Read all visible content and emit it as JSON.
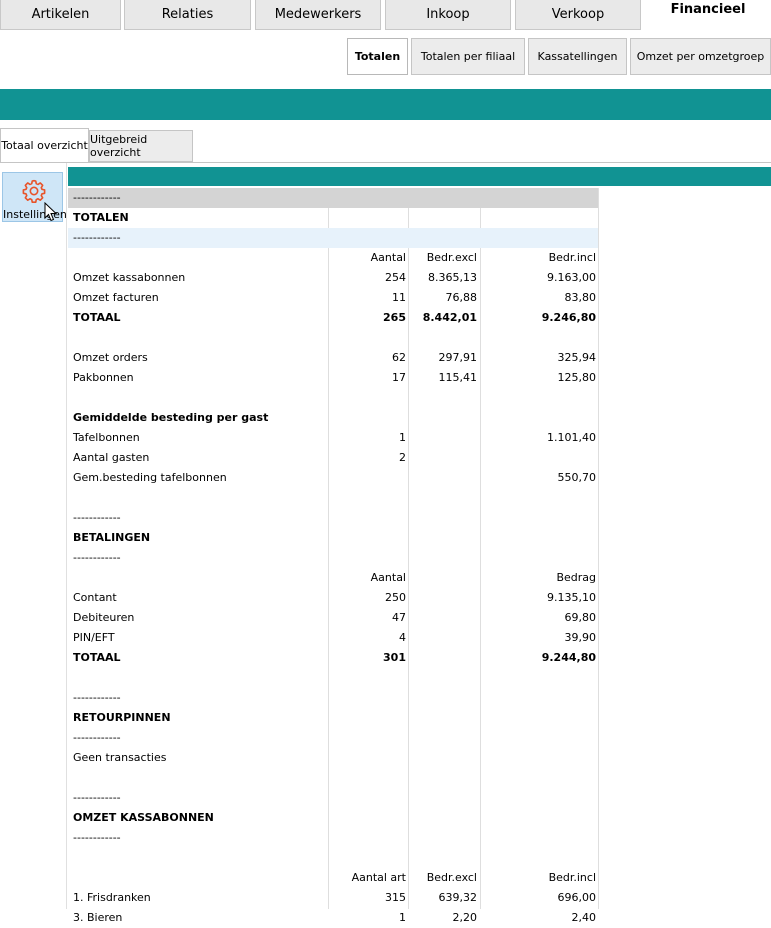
{
  "main_tabs": [
    {
      "label": "Artikelen",
      "active": false
    },
    {
      "label": "Relaties",
      "active": false
    },
    {
      "label": "Medewerkers",
      "active": false
    },
    {
      "label": "Inkoop",
      "active": false
    },
    {
      "label": "Verkoop",
      "active": false
    },
    {
      "label": "Financieel",
      "active": true
    }
  ],
  "sub_tabs": [
    {
      "label": "Totalen",
      "active": true
    },
    {
      "label": "Totalen per filiaal",
      "active": false
    },
    {
      "label": "Kassatellingen",
      "active": false
    },
    {
      "label": "Omzet per omzetgroep",
      "active": false
    }
  ],
  "view_tabs": [
    {
      "label": "Totaal overzicht",
      "active": true
    },
    {
      "label": "Uitgebreid overzicht",
      "active": false
    }
  ],
  "settings": {
    "label": "Instellingen",
    "icon": "gear-icon"
  },
  "colors": {
    "teal": "#119393",
    "icon_orange": "#e8542a",
    "header_gray": "#d4d4d4",
    "selected_blue": "#cfe6f7"
  },
  "report_rows": [
    {
      "cells": [
        "------------",
        "",
        "",
        ""
      ],
      "style": "hdr"
    },
    {
      "cells": [
        "TOTALEN",
        "",
        "",
        ""
      ],
      "style": "bold"
    },
    {
      "cells": [
        "------------",
        "",
        "",
        ""
      ],
      "style": "light"
    },
    {
      "cells": [
        "",
        "Aantal",
        "Bedr.excl",
        "Bedr.incl"
      ],
      "style": ""
    },
    {
      "cells": [
        "Omzet kassabonnen",
        "254",
        "8.365,13",
        "9.163,00"
      ],
      "style": ""
    },
    {
      "cells": [
        "Omzet facturen",
        "11",
        "76,88",
        "83,80"
      ],
      "style": ""
    },
    {
      "cells": [
        "TOTAAL",
        "265",
        "8.442,01",
        "9.246,80"
      ],
      "style": "bold"
    },
    {
      "cells": [
        "",
        "",
        "",
        ""
      ],
      "style": ""
    },
    {
      "cells": [
        "Omzet orders",
        "62",
        "297,91",
        "325,94"
      ],
      "style": ""
    },
    {
      "cells": [
        "Pakbonnen",
        "17",
        "115,41",
        "125,80"
      ],
      "style": ""
    },
    {
      "cells": [
        "",
        "",
        "",
        ""
      ],
      "style": ""
    },
    {
      "cells": [
        "Gemiddelde besteding per gast",
        "",
        "",
        ""
      ],
      "style": "bold"
    },
    {
      "cells": [
        "Tafelbonnen",
        "1",
        "",
        "1.101,40"
      ],
      "style": ""
    },
    {
      "cells": [
        "Aantal gasten",
        "2",
        "",
        ""
      ],
      "style": ""
    },
    {
      "cells": [
        "Gem.besteding tafelbonnen",
        "",
        "",
        "550,70"
      ],
      "style": ""
    },
    {
      "cells": [
        "",
        "",
        "",
        ""
      ],
      "style": ""
    },
    {
      "cells": [
        "------------",
        "",
        "",
        ""
      ],
      "style": ""
    },
    {
      "cells": [
        "BETALINGEN",
        "",
        "",
        ""
      ],
      "style": "bold"
    },
    {
      "cells": [
        "------------",
        "",
        "",
        ""
      ],
      "style": ""
    },
    {
      "cells": [
        "",
        "Aantal",
        "",
        "Bedrag"
      ],
      "style": ""
    },
    {
      "cells": [
        "Contant",
        "250",
        "",
        "9.135,10"
      ],
      "style": ""
    },
    {
      "cells": [
        "Debiteuren",
        "47",
        "",
        "69,80"
      ],
      "style": ""
    },
    {
      "cells": [
        "PIN/EFT",
        "4",
        "",
        "39,90"
      ],
      "style": ""
    },
    {
      "cells": [
        "TOTAAL",
        "301",
        "",
        "9.244,80"
      ],
      "style": "bold"
    },
    {
      "cells": [
        "",
        "",
        "",
        ""
      ],
      "style": ""
    },
    {
      "cells": [
        "------------",
        "",
        "",
        ""
      ],
      "style": ""
    },
    {
      "cells": [
        "RETOURPINNEN",
        "",
        "",
        ""
      ],
      "style": "bold"
    },
    {
      "cells": [
        "------------",
        "",
        "",
        ""
      ],
      "style": ""
    },
    {
      "cells": [
        "Geen transacties",
        "",
        "",
        ""
      ],
      "style": ""
    },
    {
      "cells": [
        "",
        "",
        "",
        ""
      ],
      "style": ""
    },
    {
      "cells": [
        "------------",
        "",
        "",
        ""
      ],
      "style": ""
    },
    {
      "cells": [
        "OMZET KASSABONNEN",
        "",
        "",
        ""
      ],
      "style": "bold"
    },
    {
      "cells": [
        "------------",
        "",
        "",
        ""
      ],
      "style": ""
    },
    {
      "cells": [
        "",
        "",
        "",
        ""
      ],
      "style": ""
    },
    {
      "cells": [
        "",
        "Aantal art",
        "Bedr.excl",
        "Bedr.incl"
      ],
      "style": ""
    },
    {
      "cells": [
        "1. Frisdranken",
        "315",
        "639,32",
        "696,00"
      ],
      "style": ""
    },
    {
      "cells": [
        "3. Bieren",
        "1",
        "2,20",
        "2,40"
      ],
      "style": ""
    }
  ]
}
